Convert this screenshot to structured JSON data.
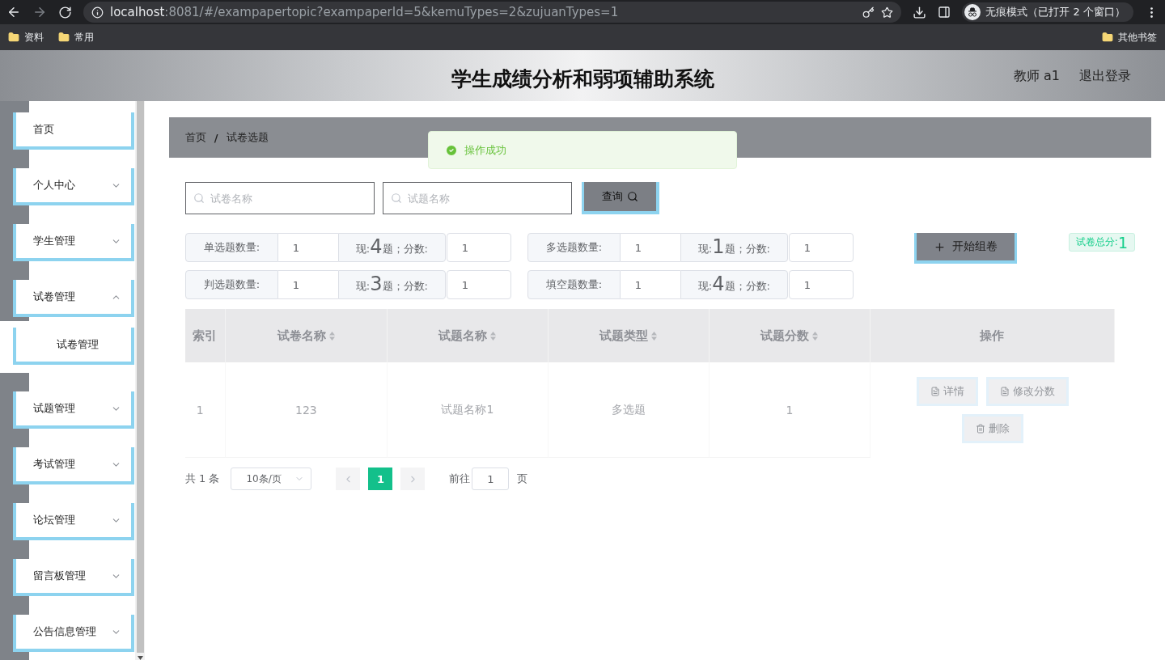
{
  "browser": {
    "url_host": "localhost",
    "url_rest": ":8081/#/exampapertopic?exampaperId=5&kemuTypes=2&zujuanTypes=1",
    "bookmarks": [
      "资料",
      "常用"
    ],
    "other_bookmarks": "其他书签",
    "incognito": "无痕模式（已打开 2 个窗口）"
  },
  "header": {
    "title": "学生成绩分析和弱项辅助系统",
    "user": "教师 a1",
    "logout": "退出登录"
  },
  "toast": {
    "text": "操作成功"
  },
  "sidebar": {
    "items": [
      {
        "label": "首页",
        "expandable": false
      },
      {
        "label": "个人中心",
        "expandable": true,
        "expanded": false
      },
      {
        "label": "学生管理",
        "expandable": true,
        "expanded": false
      },
      {
        "label": "试卷管理",
        "expandable": true,
        "expanded": true,
        "children": [
          {
            "label": "试卷管理"
          }
        ]
      },
      {
        "label": "试题管理",
        "expandable": true,
        "expanded": false
      },
      {
        "label": "考试管理",
        "expandable": true,
        "expanded": false
      },
      {
        "label": "论坛管理",
        "expandable": true,
        "expanded": false
      },
      {
        "label": "留言板管理",
        "expandable": true,
        "expanded": false
      },
      {
        "label": "公告信息管理",
        "expandable": true,
        "expanded": false
      }
    ]
  },
  "breadcrumb": {
    "items": [
      "首页",
      "试卷选题"
    ],
    "separator": "/"
  },
  "search": {
    "fields": [
      {
        "placeholder": "试卷名称"
      },
      {
        "placeholder": "试题名称"
      }
    ],
    "button": "查询"
  },
  "counts": [
    {
      "label": "单选题数量:",
      "value": "1",
      "now_prefix": "现:",
      "now_count": "4",
      "now_suffix": "题；分数:",
      "score": "1"
    },
    {
      "label": "多选题数量:",
      "value": "1",
      "now_prefix": "现:",
      "now_count": "1",
      "now_suffix": "题；分数:",
      "score": "1"
    },
    {
      "label": "判选题数量:",
      "value": "1",
      "now_prefix": "现:",
      "now_count": "3",
      "now_suffix": "题；分数:",
      "score": "1"
    },
    {
      "label": "填空题数量:",
      "value": "1",
      "now_prefix": "现:",
      "now_count": "4",
      "now_suffix": "题；分数:",
      "score": "1"
    }
  ],
  "compose_button": "开始组卷",
  "total": {
    "label": "试卷总分:",
    "value": "1"
  },
  "table": {
    "columns": [
      {
        "label": "索引",
        "sortable": false
      },
      {
        "label": "试卷名称",
        "sortable": true
      },
      {
        "label": "试题名称",
        "sortable": true
      },
      {
        "label": "试题类型",
        "sortable": true
      },
      {
        "label": "试题分数",
        "sortable": true
      },
      {
        "label": "操作",
        "sortable": false
      }
    ],
    "rows": [
      {
        "cells": [
          "1",
          "123",
          "试题名称1",
          "多选题",
          "1"
        ],
        "actions": [
          "详情",
          "修改分数",
          "删除"
        ]
      }
    ]
  },
  "pagination": {
    "total": "共 1 条",
    "page_size": "10条/页",
    "pages": [
      {
        "label": "1",
        "selected": true
      }
    ],
    "goto_label": "前往",
    "goto_value": "1",
    "goto_suffix": "页"
  }
}
